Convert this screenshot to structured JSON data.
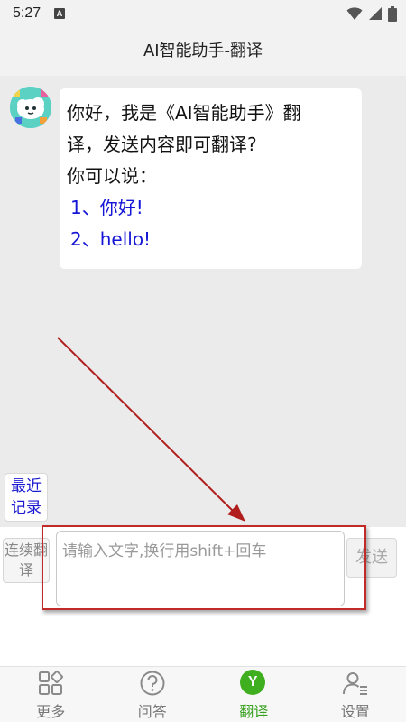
{
  "status_bar": {
    "time": "5:27",
    "app_icon_letter": "A"
  },
  "header": {
    "title": "AI智能助手-翻译"
  },
  "chat": {
    "bot_message": {
      "line1": "你好，我是《AI智能助手》翻",
      "line2": "译，发送内容即可翻译?",
      "line3": "你可以说：",
      "example1": "1、你好!",
      "example2": "2、hello!"
    },
    "recent_button_label": "最近记录"
  },
  "input": {
    "continuous_button_label": "连续翻译",
    "placeholder": "请输入文字,换行用shift+回车",
    "value": "",
    "send_label": "发送"
  },
  "bottom_nav": {
    "items": [
      {
        "label": "更多",
        "icon": "grid-icon"
      },
      {
        "label": "问答",
        "icon": "question-icon"
      },
      {
        "label": "翻译",
        "icon": "translate-y-icon",
        "active": true,
        "icon_letter": "Y"
      },
      {
        "label": "设置",
        "icon": "user-settings-icon"
      }
    ]
  },
  "colors": {
    "accent_green": "#3fae1f",
    "link_blue": "#1515d6",
    "annotation_red": "#c22a2a"
  }
}
